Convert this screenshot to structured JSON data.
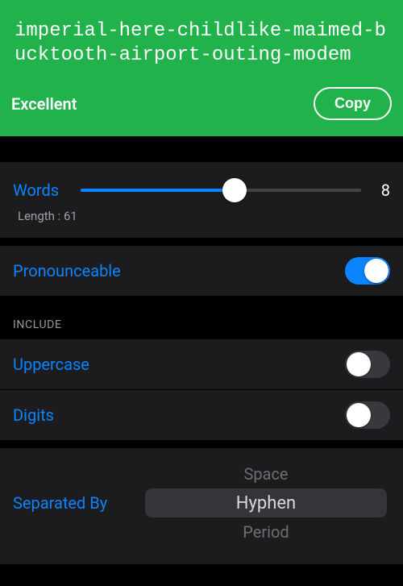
{
  "password": "imperial-here-childlike-maimed-bucktooth-airport-outing-modem",
  "strength": "Excellent",
  "copy_label": "Copy",
  "words": {
    "label": "Words",
    "value": "8",
    "min": 3,
    "max": 12,
    "fill_pct": 55
  },
  "length_text": "Length : 61",
  "pronounceable": {
    "label": "Pronounceable",
    "on": true
  },
  "include_title": "INCLUDE",
  "uppercase": {
    "label": "Uppercase",
    "on": false
  },
  "digits": {
    "label": "Digits",
    "on": false
  },
  "separator": {
    "label": "Separated By",
    "options": [
      "Space",
      "Hyphen",
      "Period"
    ],
    "selected": "Hyphen"
  }
}
